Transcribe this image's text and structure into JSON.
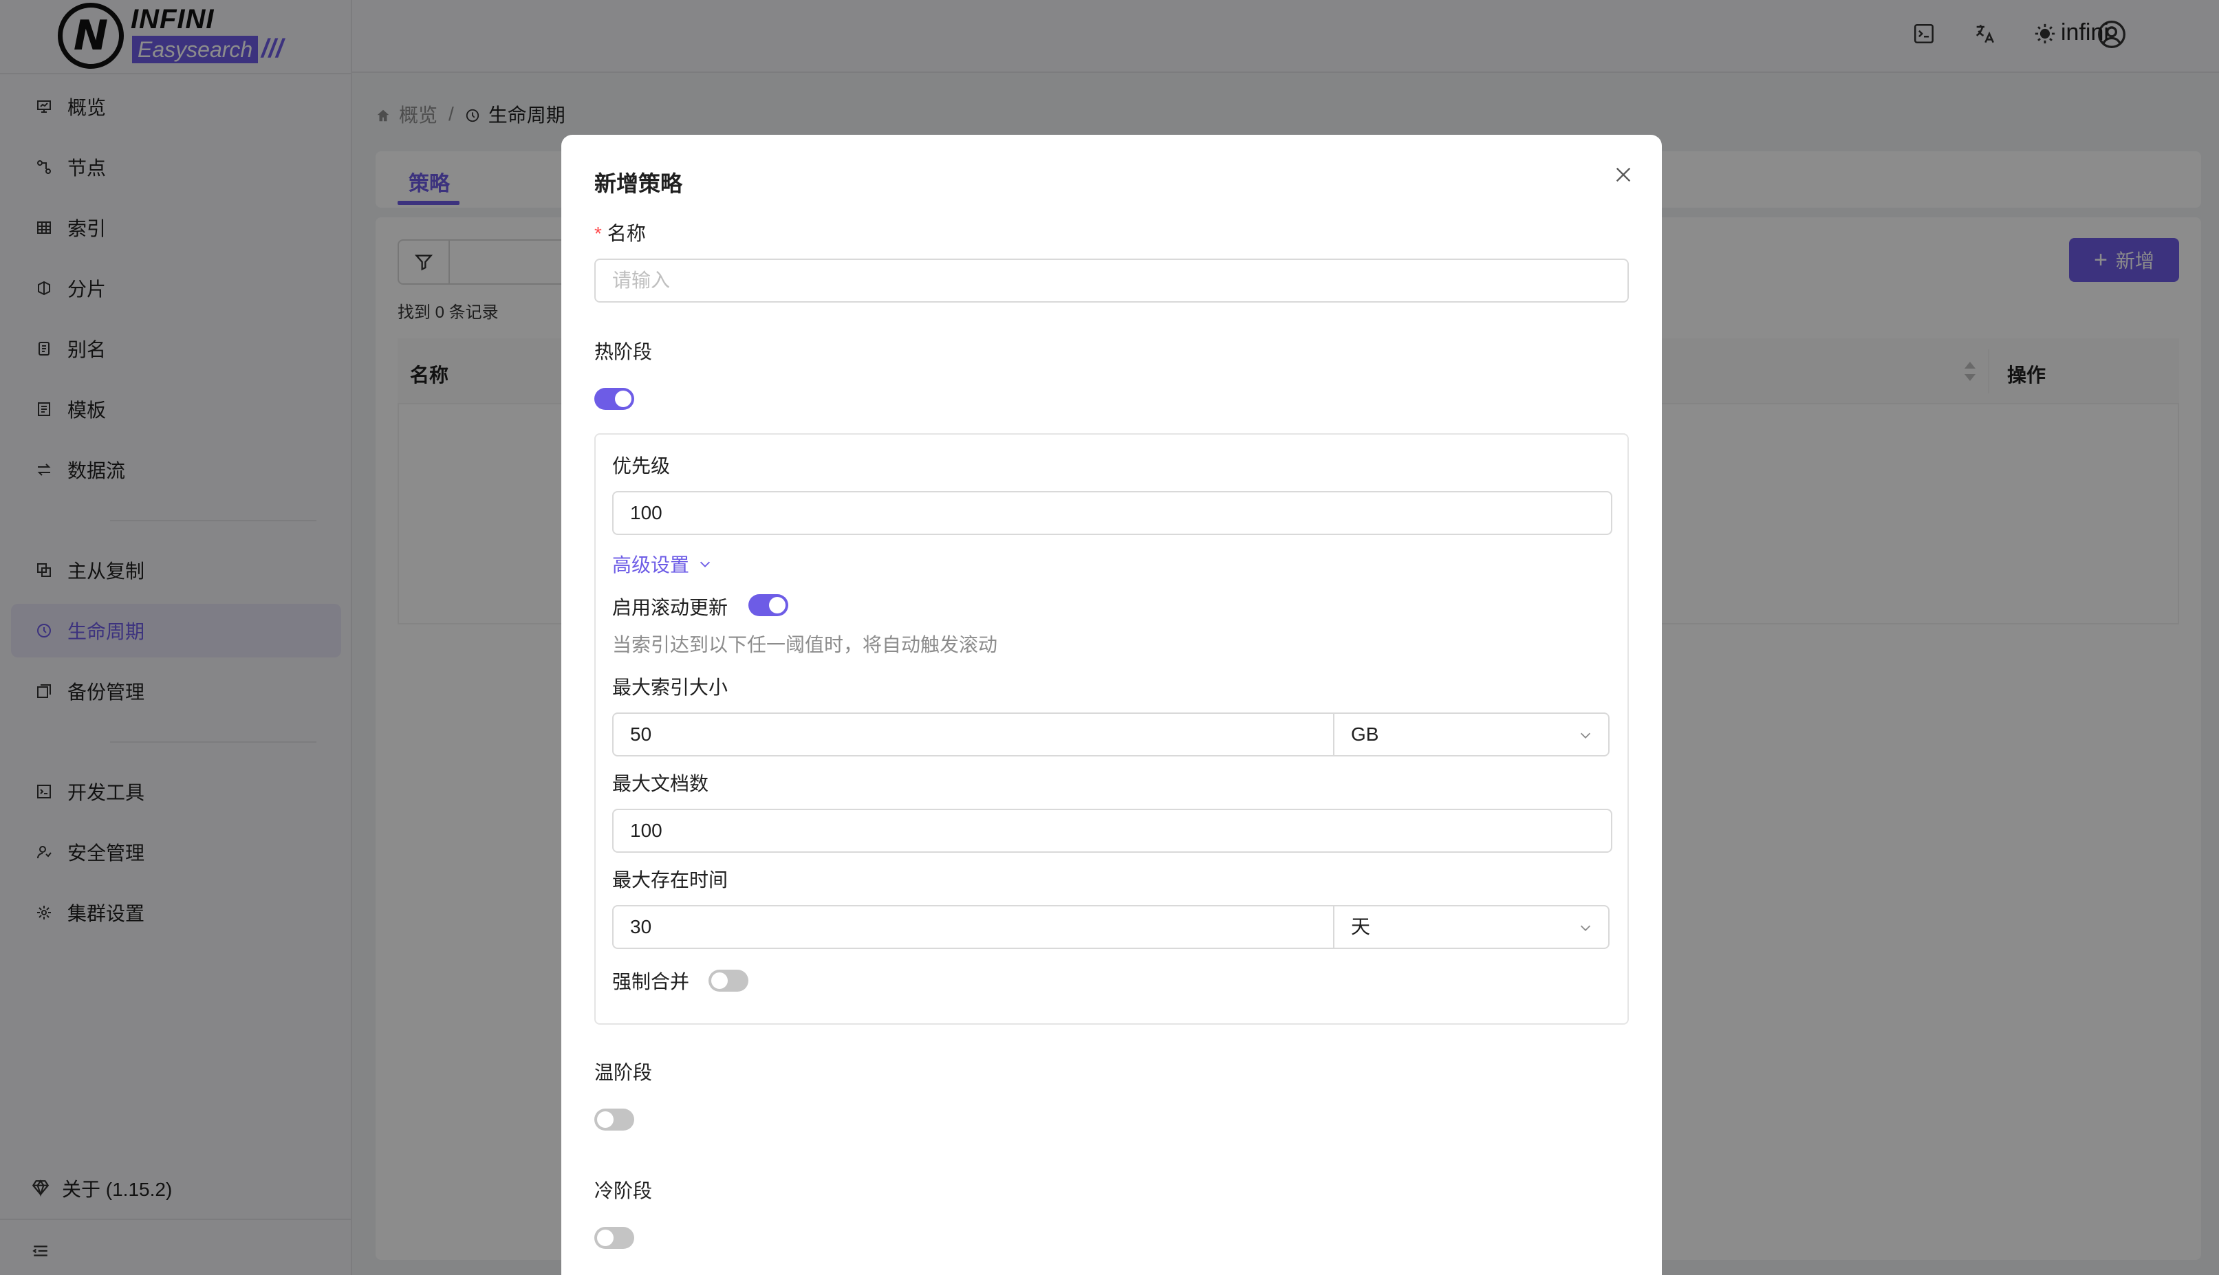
{
  "app": {
    "logo_top": "INFINI",
    "logo_bottom": "Easysearch",
    "logo_mark": "N",
    "logo_slashes": "///"
  },
  "sidebar": {
    "items": [
      {
        "label": "概览",
        "icon": "overview-icon"
      },
      {
        "label": "节点",
        "icon": "nodes-icon"
      },
      {
        "label": "索引",
        "icon": "index-icon"
      },
      {
        "label": "分片",
        "icon": "shards-icon"
      },
      {
        "label": "别名",
        "icon": "alias-icon"
      },
      {
        "label": "模板",
        "icon": "template-icon"
      },
      {
        "label": "数据流",
        "icon": "datastream-icon"
      },
      {
        "label": "主从复制",
        "icon": "replication-icon"
      },
      {
        "label": "生命周期",
        "icon": "lifecycle-icon",
        "active": true
      },
      {
        "label": "备份管理",
        "icon": "backup-icon"
      },
      {
        "label": "开发工具",
        "icon": "devtools-icon"
      },
      {
        "label": "安全管理",
        "icon": "security-icon"
      },
      {
        "label": "集群设置",
        "icon": "settings-icon"
      }
    ],
    "about": "关于 (1.15.2)"
  },
  "topbar": {
    "user": "infini"
  },
  "breadcrumb": {
    "home": "概览",
    "separator": "/",
    "current": "生命周期"
  },
  "tabs": {
    "active": "策略"
  },
  "list": {
    "found": "找到 0 条记录",
    "add_button": "新增",
    "columns": {
      "name": "名称",
      "actions": "操作"
    }
  },
  "modal": {
    "title": "新增策略",
    "name_label": "名称",
    "name_placeholder": "请输入",
    "hot": {
      "label": "热阶段",
      "enabled": true,
      "priority_label": "优先级",
      "priority_value": "100",
      "advanced": "高级设置",
      "rollover_label": "启用滚动更新",
      "rollover_enabled": true,
      "rollover_hint": "当索引达到以下任一阈值时，将自动触发滚动",
      "max_size_label": "最大索引大小",
      "max_size_value": "50",
      "max_size_unit": "GB",
      "max_docs_label": "最大文档数",
      "max_docs_value": "100",
      "max_age_label": "最大存在时间",
      "max_age_value": "30",
      "max_age_unit": "天",
      "forcemerge_label": "强制合并",
      "forcemerge_enabled": false
    },
    "warm": {
      "label": "温阶段",
      "enabled": false
    },
    "cold": {
      "label": "冷阶段",
      "enabled": false
    }
  },
  "colors": {
    "accent": "#6d5ce6",
    "required": "#ff4d4f",
    "switch_off": "#c4c4c4"
  }
}
